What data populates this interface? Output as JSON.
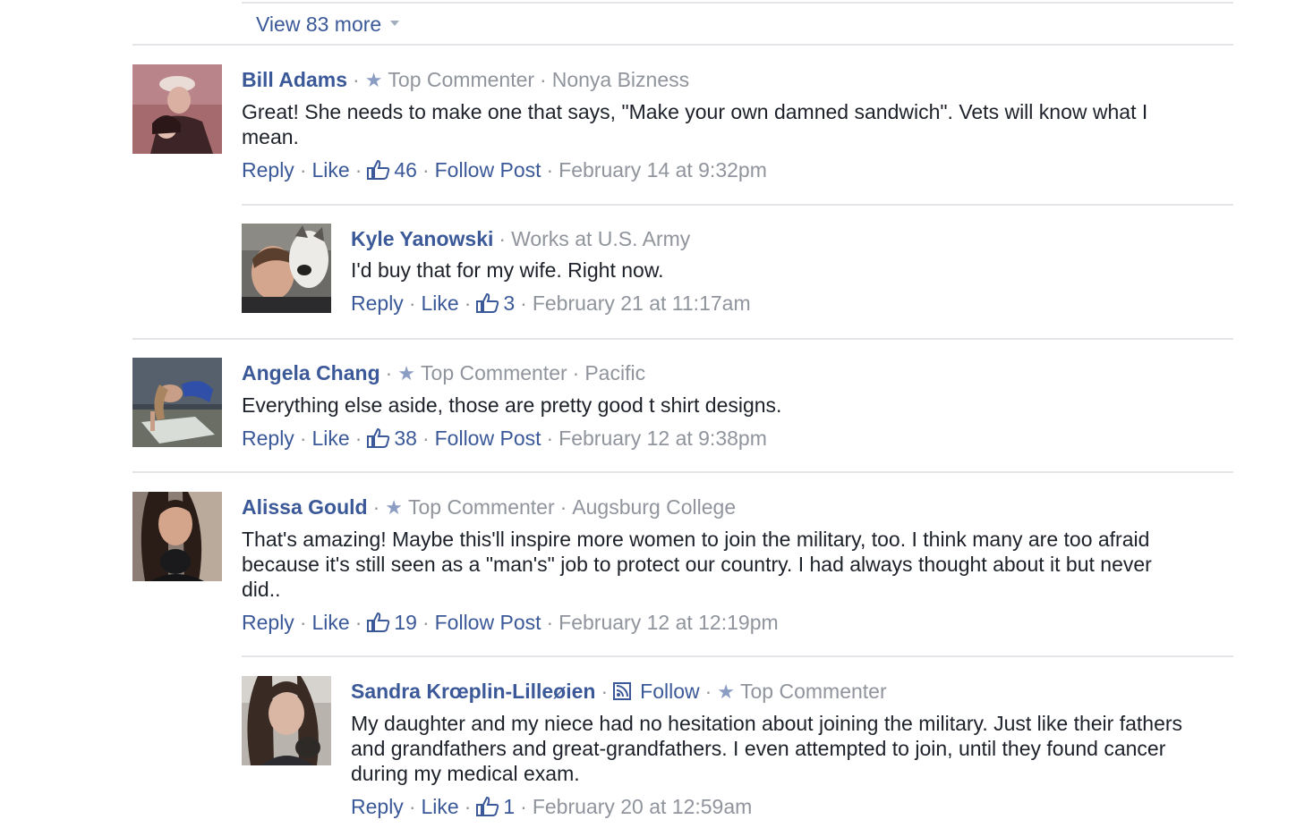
{
  "view_more": {
    "label": "View 83 more"
  },
  "comments": [
    {
      "name": "Bill Adams",
      "badge": "Top Commenter",
      "affiliation": "Nonya Bizness",
      "text": "Great! She needs to make one that says, \"Make your own damned sandwich\". Vets will know what I mean.",
      "reply": "Reply",
      "like": "Like",
      "likes": "46",
      "follow_post": "Follow Post",
      "time": "February 14 at 9:32pm",
      "replies": [
        {
          "name": "Kyle Yanowski",
          "works_prefix": "Works at",
          "employer": "U.S. Army",
          "text": "I'd buy that for my wife. Right now.",
          "reply": "Reply",
          "like": "Like",
          "likes": "3",
          "time": "February 21 at 11:17am"
        }
      ]
    },
    {
      "name": "Angela Chang",
      "badge": "Top Commenter",
      "affiliation": "Pacific",
      "text": "Everything else aside, those are pretty good t shirt designs.",
      "reply": "Reply",
      "like": "Like",
      "likes": "38",
      "follow_post": "Follow Post",
      "time": "February 12 at 9:38pm"
    },
    {
      "name": "Alissa Gould",
      "badge": "Top Commenter",
      "affiliation": "Augsburg College",
      "text": "That's amazing! Maybe this'll inspire more women to join the military, too. I think many are too afraid because it's still seen as a \"man's\" job to protect our country. I had always thought about it but never did..",
      "reply": "Reply",
      "like": "Like",
      "likes": "19",
      "follow_post": "Follow Post",
      "time": "February 12 at 12:19pm",
      "replies": [
        {
          "name": "Sandra Krœplin-Lilleøien",
          "follow": "Follow",
          "badge": "Top Commenter",
          "text": "My daughter and my niece had no hesitation about joining the military. Just like their fathers and grandfathers and great-grandfathers. I even attempted to join, until they found cancer during my medical exam.",
          "reply": "Reply",
          "like": "Like",
          "likes": "1",
          "time": "February 20 at 12:59am"
        }
      ]
    }
  ],
  "colors": {
    "link": "#3b5998",
    "meta": "#90949c",
    "text": "#1d2129",
    "divider": "#e4e5e8",
    "star": "#8b9dc3"
  },
  "icons": [
    "chevron-down-icon",
    "star-icon",
    "thumbs-up-icon",
    "rss-follow-icon"
  ]
}
